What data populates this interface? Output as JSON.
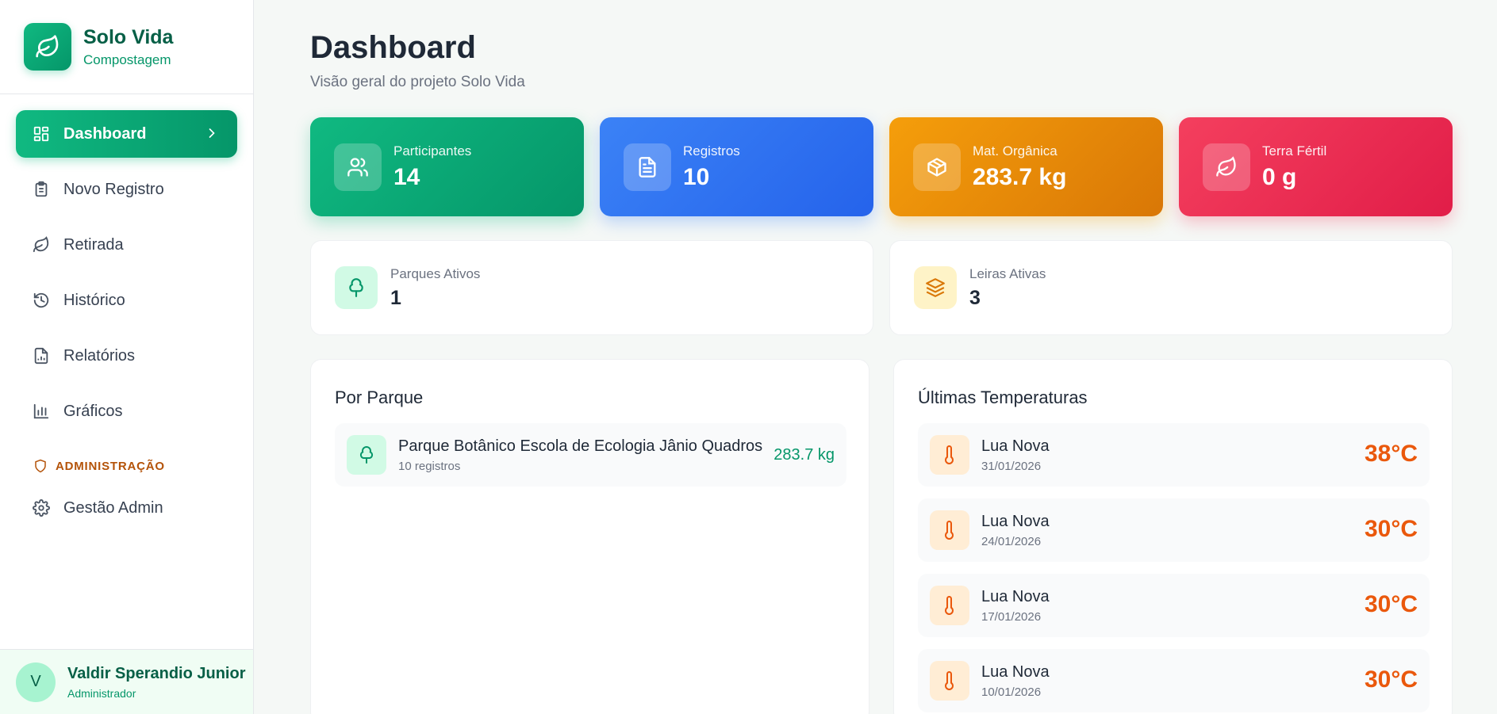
{
  "brand": {
    "name": "Solo Vida",
    "subtitle": "Compostagem",
    "logo_icon": "leaf-icon"
  },
  "nav": {
    "items": [
      {
        "label": "Dashboard",
        "icon": "dashboard-grid-icon",
        "active": true
      },
      {
        "label": "Novo Registro",
        "icon": "clipboard-icon"
      },
      {
        "label": "Retirada",
        "icon": "leaf-icon"
      },
      {
        "label": "Histórico",
        "icon": "history-icon"
      },
      {
        "label": "Relatórios",
        "icon": "report-file-icon"
      },
      {
        "label": "Gráficos",
        "icon": "bar-chart-icon"
      }
    ],
    "admin_section_label": "ADMINISTRAÇÃO",
    "admin_items": [
      {
        "label": "Gestão Admin",
        "icon": "gear-icon"
      }
    ]
  },
  "user": {
    "initial": "V",
    "name": "Valdir Sperandio Junior",
    "role": "Administrador"
  },
  "header": {
    "title": "Dashboard",
    "subtitle": "Visão geral do projeto Solo Vida"
  },
  "stats": [
    {
      "label": "Participantes",
      "value": "14",
      "icon": "users-icon",
      "color": "#10b981"
    },
    {
      "label": "Registros",
      "value": "10",
      "icon": "document-icon",
      "color": "#3b82f6"
    },
    {
      "label": "Mat. Orgânica",
      "value": "283.7 kg",
      "icon": "package-icon",
      "color": "#f59e0b"
    },
    {
      "label": "Terra Fértil",
      "value": "0 g",
      "icon": "leaf-icon",
      "color": "#f43f5e"
    }
  ],
  "info": [
    {
      "label": "Parques Ativos",
      "value": "1",
      "icon": "tree-icon"
    },
    {
      "label": "Leiras Ativas",
      "value": "3",
      "icon": "layers-icon"
    }
  ],
  "parks_panel": {
    "title": "Por Parque",
    "items": [
      {
        "name": "Parque Botânico Escola de Ecologia Jânio Quadros",
        "count": "10 registros",
        "weight": "283.7 kg"
      }
    ]
  },
  "temps_panel": {
    "title": "Últimas Temperaturas",
    "items": [
      {
        "name": "Lua Nova",
        "date": "31/01/2026",
        "value": "38°C"
      },
      {
        "name": "Lua Nova",
        "date": "24/01/2026",
        "value": "30°C"
      },
      {
        "name": "Lua Nova",
        "date": "17/01/2026",
        "value": "30°C"
      },
      {
        "name": "Lua Nova",
        "date": "10/01/2026",
        "value": "30°C"
      }
    ]
  }
}
